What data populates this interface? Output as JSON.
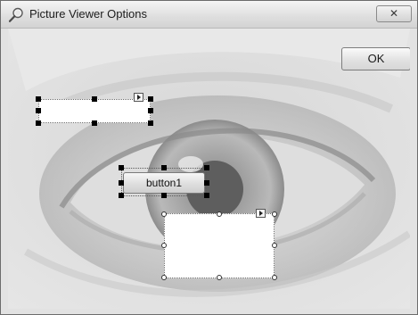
{
  "window": {
    "title": "Picture Viewer Options",
    "close_glyph": "✕",
    "ok_label": "OK",
    "button1_label": "button1"
  },
  "icons": {
    "title_icon": "magnifier-icon",
    "close_icon": "close-icon",
    "smart_tag_icon": "smart-tag-arrow-icon"
  }
}
